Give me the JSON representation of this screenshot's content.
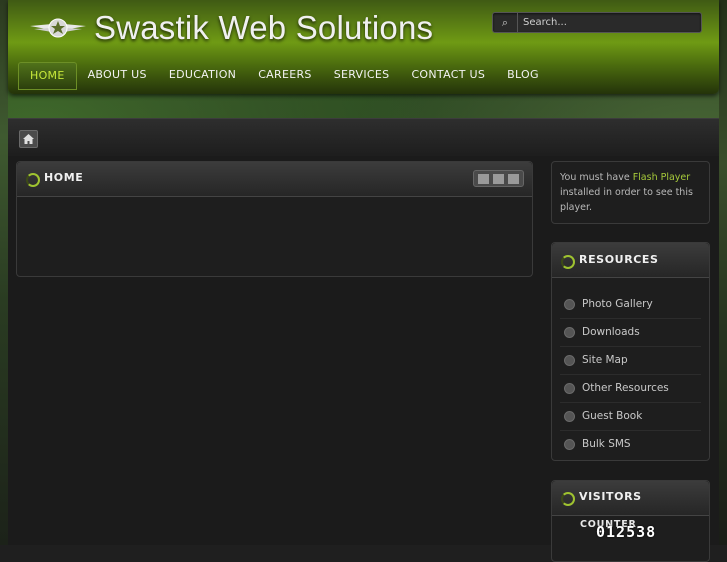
{
  "site": {
    "title": "Swastik Web Solutions",
    "logo_icon": "winged-star-emblem-icon"
  },
  "search": {
    "placeholder": "Search...",
    "icon": "search-icon"
  },
  "nav": {
    "items": [
      {
        "label": "HOME",
        "active": true
      },
      {
        "label": "ABOUT US",
        "active": false
      },
      {
        "label": "EDUCATION",
        "active": false
      },
      {
        "label": "CAREERS",
        "active": false
      },
      {
        "label": "SERVICES",
        "active": false
      },
      {
        "label": "CONTACT US",
        "active": false
      },
      {
        "label": "BLOG",
        "active": false
      }
    ]
  },
  "breadcrumb": {
    "home_icon": "home-icon"
  },
  "main": {
    "panel_title": "HOME",
    "tools": [
      "email-icon",
      "print-icon",
      "pdf-icon"
    ]
  },
  "sidebar": {
    "flash": {
      "text_before": "You must have ",
      "link": "Flash Player",
      "text_after": " installed in order to see this player."
    },
    "resources": {
      "title": "RESOURCES",
      "items": [
        {
          "label": "Photo Gallery"
        },
        {
          "label": "Downloads"
        },
        {
          "label": "Site Map"
        },
        {
          "label": "Other Resources"
        },
        {
          "label": "Guest Book"
        },
        {
          "label": "Bulk SMS"
        }
      ]
    },
    "visitors": {
      "title": "VISITORS",
      "label": "COUNTER",
      "count": "012538"
    }
  },
  "colors": {
    "accent": "#a6c93a",
    "header_green": "#6f9a14",
    "panel_bg": "#1e1e1e"
  }
}
